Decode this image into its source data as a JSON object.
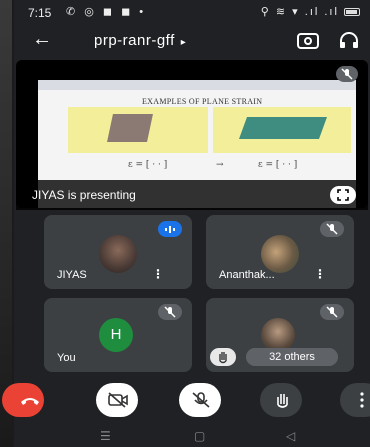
{
  "status": {
    "time": "7:15",
    "left_icons": "✆ ◎ ◼ ◼ •",
    "right_icons": "⚲ ≋ ▾ .ıl .ıl"
  },
  "meeting": {
    "title": "prp-ranr-gff",
    "title_chevron": "▸"
  },
  "presentation": {
    "slide_title": "EXAMPLES OF PLANE STRAIN",
    "formula_left": "ε = [ · · ]",
    "formula_mid": "→",
    "formula_right": "ε = [ · · ]",
    "presenter_label": "JIYAS is presenting"
  },
  "participants": [
    {
      "name": "JIYAS",
      "more": "⋮"
    },
    {
      "name": "Ananthak...",
      "more": "⋮"
    },
    {
      "name": "You",
      "initial": "H"
    },
    {
      "others_label": "32 others"
    }
  ],
  "colors": {
    "end_call": "#ea4335",
    "you_avatar": "#1e8e3e",
    "speaking_badge": "#1a73e8"
  },
  "icons": {
    "back": "←",
    "nav_recent": "☰",
    "nav_home": "▢",
    "nav_back": "◁"
  }
}
